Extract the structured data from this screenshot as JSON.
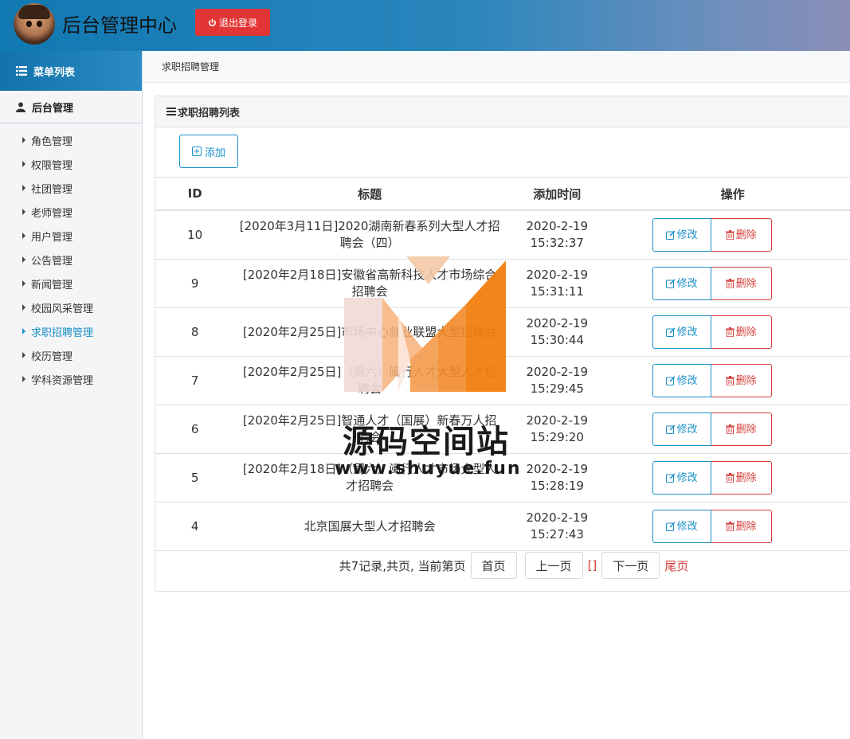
{
  "header": {
    "app_title": "后台管理中心",
    "logout_label": "退出登录",
    "avatar_icon": "avatar-icon",
    "logout_icon": "power-icon"
  },
  "sidebar": {
    "menu_title": "菜单列表",
    "group_title": "后台管理",
    "items": [
      {
        "label": "角色管理"
      },
      {
        "label": "权限管理"
      },
      {
        "label": "社团管理"
      },
      {
        "label": "老师管理"
      },
      {
        "label": "用户管理"
      },
      {
        "label": "公告管理"
      },
      {
        "label": "新闻管理"
      },
      {
        "label": "校园风采管理"
      },
      {
        "label": "求职招聘管理"
      },
      {
        "label": "校历管理"
      },
      {
        "label": "学科资源管理"
      }
    ],
    "active_item": "求职招聘管理"
  },
  "breadcrumb": "求职招聘管理",
  "panel": {
    "title": "求职招聘列表",
    "add_label": "添加"
  },
  "table": {
    "headers": {
      "id": "ID",
      "title": "标题",
      "time": "添加时间",
      "op": "操作"
    },
    "edit_label": "修改",
    "delete_label": "删除",
    "rows": [
      {
        "id": "10",
        "title": "[2020年3月11日]2020湖南新春系列大型人才招聘会（四）",
        "time": "2020-2-19 15:32:37"
      },
      {
        "id": "9",
        "title": "[2020年2月18日]安徽省高新科技人才市场综合招聘会",
        "time": "2020-2-19 15:31:11"
      },
      {
        "id": "8",
        "title": "[2020年2月25日]市场中心就业联盟大型招聘会",
        "time": "2020-2-19 15:30:44"
      },
      {
        "id": "7",
        "title": "[2020年2月25日]（周六）闽行人才大型人才招聘会",
        "time": "2020-2-19 15:29:45"
      },
      {
        "id": "6",
        "title": "[2020年2月25日]智通人才（国展）新春万人招聘会",
        "time": "2020-2-19 15:29:20"
      },
      {
        "id": "5",
        "title": "[2020年2月18日]（周六）闽行人才市场大型人才招聘会",
        "time": "2020-2-19 15:28:19"
      },
      {
        "id": "4",
        "title": "北京国展大型人才招聘会",
        "time": "2020-2-19 15:27:43"
      }
    ]
  },
  "pager": {
    "summary": "共7记录,共页, 当前第页",
    "first": "首页",
    "prev": "上一页",
    "current": "[]",
    "next": "下一页",
    "last": "尾页"
  },
  "watermark": {
    "name": "源码空间站",
    "url": "www.shuyue.fun"
  },
  "colors": {
    "accent": "#1a90c8",
    "danger": "#d43f3a",
    "logout_bg": "#e23535"
  }
}
